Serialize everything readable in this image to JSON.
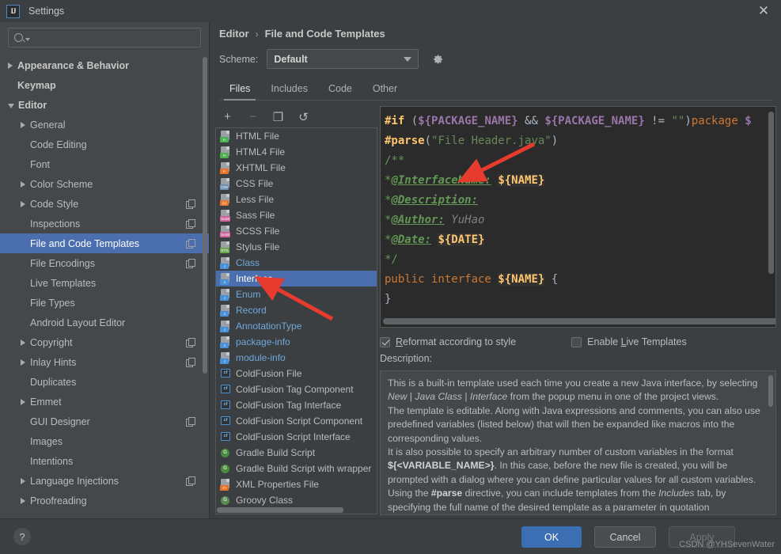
{
  "window": {
    "title": "Settings",
    "logo_text": "IJ",
    "close_label": "✕"
  },
  "sidebar": {
    "search_placeholder": "",
    "search_value": "",
    "items": [
      {
        "label": "Appearance & Behavior",
        "indent": 0,
        "arrow": "closed",
        "bold": true,
        "copy": false,
        "selected": false
      },
      {
        "label": "Keymap",
        "indent": 0,
        "arrow": "none",
        "bold": true,
        "copy": false,
        "selected": false
      },
      {
        "label": "Editor",
        "indent": 0,
        "arrow": "open",
        "bold": true,
        "copy": false,
        "selected": false
      },
      {
        "label": "General",
        "indent": 1,
        "arrow": "closed",
        "bold": false,
        "copy": false,
        "selected": false
      },
      {
        "label": "Code Editing",
        "indent": 1,
        "arrow": "none",
        "bold": false,
        "copy": false,
        "selected": false
      },
      {
        "label": "Font",
        "indent": 1,
        "arrow": "none",
        "bold": false,
        "copy": false,
        "selected": false
      },
      {
        "label": "Color Scheme",
        "indent": 1,
        "arrow": "closed",
        "bold": false,
        "copy": false,
        "selected": false
      },
      {
        "label": "Code Style",
        "indent": 1,
        "arrow": "closed",
        "bold": false,
        "copy": true,
        "selected": false
      },
      {
        "label": "Inspections",
        "indent": 1,
        "arrow": "none",
        "bold": false,
        "copy": true,
        "selected": false
      },
      {
        "label": "File and Code Templates",
        "indent": 1,
        "arrow": "none",
        "bold": false,
        "copy": true,
        "selected": true
      },
      {
        "label": "File Encodings",
        "indent": 1,
        "arrow": "none",
        "bold": false,
        "copy": true,
        "selected": false
      },
      {
        "label": "Live Templates",
        "indent": 1,
        "arrow": "none",
        "bold": false,
        "copy": false,
        "selected": false
      },
      {
        "label": "File Types",
        "indent": 1,
        "arrow": "none",
        "bold": false,
        "copy": false,
        "selected": false
      },
      {
        "label": "Android Layout Editor",
        "indent": 1,
        "arrow": "none",
        "bold": false,
        "copy": false,
        "selected": false
      },
      {
        "label": "Copyright",
        "indent": 1,
        "arrow": "closed",
        "bold": false,
        "copy": true,
        "selected": false
      },
      {
        "label": "Inlay Hints",
        "indent": 1,
        "arrow": "closed",
        "bold": false,
        "copy": true,
        "selected": false
      },
      {
        "label": "Duplicates",
        "indent": 1,
        "arrow": "none",
        "bold": false,
        "copy": false,
        "selected": false
      },
      {
        "label": "Emmet",
        "indent": 1,
        "arrow": "closed",
        "bold": false,
        "copy": false,
        "selected": false
      },
      {
        "label": "GUI Designer",
        "indent": 1,
        "arrow": "none",
        "bold": false,
        "copy": true,
        "selected": false
      },
      {
        "label": "Images",
        "indent": 1,
        "arrow": "none",
        "bold": false,
        "copy": false,
        "selected": false
      },
      {
        "label": "Intentions",
        "indent": 1,
        "arrow": "none",
        "bold": false,
        "copy": false,
        "selected": false
      },
      {
        "label": "Language Injections",
        "indent": 1,
        "arrow": "closed",
        "bold": false,
        "copy": true,
        "selected": false
      },
      {
        "label": "Proofreading",
        "indent": 1,
        "arrow": "closed",
        "bold": false,
        "copy": false,
        "selected": false
      }
    ]
  },
  "header": {
    "breadcrumb_parent": "Editor",
    "breadcrumb_sep": "›",
    "breadcrumb_current": "File and Code Templates",
    "scheme_label": "Scheme:",
    "scheme_value": "Default",
    "gear_icon": "gear-icon"
  },
  "tabs": [
    {
      "label": "Files",
      "active": true
    },
    {
      "label": "Includes",
      "active": false
    },
    {
      "label": "Code",
      "active": false
    },
    {
      "label": "Other",
      "active": false
    }
  ],
  "list_toolbar": [
    {
      "name": "add-template-button",
      "glyph": "+",
      "disabled": false
    },
    {
      "name": "remove-template-button",
      "glyph": "−",
      "disabled": true
    },
    {
      "name": "copy-template-button",
      "glyph": "❐",
      "disabled": false
    },
    {
      "name": "reset-template-button",
      "glyph": "↺",
      "disabled": false
    }
  ],
  "templates": [
    {
      "label": "HTML File",
      "icon": "html-file-icon",
      "kind": "badge",
      "badge": "H",
      "badge_color": "#4caf50",
      "selected": false,
      "java": false
    },
    {
      "label": "HTML4 File",
      "icon": "html4-file-icon",
      "kind": "badge",
      "badge": "H",
      "badge_color": "#4caf50",
      "selected": false,
      "java": false
    },
    {
      "label": "XHTML File",
      "icon": "xhtml-file-icon",
      "kind": "badge",
      "badge": "H",
      "badge_color": "#e8722a",
      "selected": false,
      "java": false
    },
    {
      "label": "CSS File",
      "icon": "css-file-icon",
      "kind": "badge",
      "badge": "CSS",
      "badge_color": "#6b8fb5",
      "selected": false,
      "java": false
    },
    {
      "label": "Less File",
      "icon": "less-file-icon",
      "kind": "badge",
      "badge": "{L}",
      "badge_color": "#e8722a",
      "selected": false,
      "java": false
    },
    {
      "label": "Sass File",
      "icon": "sass-file-icon",
      "kind": "badge",
      "badge": "SASS",
      "badge_color": "#cf649a",
      "selected": false,
      "java": false
    },
    {
      "label": "SCSS File",
      "icon": "scss-file-icon",
      "kind": "badge",
      "badge": "SASS",
      "badge_color": "#cf649a",
      "selected": false,
      "java": false
    },
    {
      "label": "Stylus File",
      "icon": "stylus-file-icon",
      "kind": "badge",
      "badge": "STYL",
      "badge_color": "#6aa84f",
      "selected": false,
      "java": false
    },
    {
      "label": "Class",
      "icon": "java-class-icon",
      "kind": "badge",
      "badge": "J",
      "badge_color": "#4a90d9",
      "selected": false,
      "java": true
    },
    {
      "label": "Interface",
      "icon": "java-interface-icon",
      "kind": "badge",
      "badge": "J",
      "badge_color": "#4a90d9",
      "selected": true,
      "java": true
    },
    {
      "label": "Enum",
      "icon": "java-enum-icon",
      "kind": "badge",
      "badge": "J",
      "badge_color": "#4a90d9",
      "selected": false,
      "java": true
    },
    {
      "label": "Record",
      "icon": "java-record-icon",
      "kind": "badge",
      "badge": "J",
      "badge_color": "#4a90d9",
      "selected": false,
      "java": true
    },
    {
      "label": "AnnotationType",
      "icon": "java-annotation-icon",
      "kind": "badge",
      "badge": "J",
      "badge_color": "#4a90d9",
      "selected": false,
      "java": true
    },
    {
      "label": "package-info",
      "icon": "package-info-icon",
      "kind": "badge",
      "badge": "J",
      "badge_color": "#4a90d9",
      "selected": false,
      "java": true
    },
    {
      "label": "module-info",
      "icon": "module-info-icon",
      "kind": "badge",
      "badge": "J",
      "badge_color": "#4a90d9",
      "selected": false,
      "java": true
    },
    {
      "label": "ColdFusion File",
      "icon": "coldfusion-icon",
      "kind": "cf",
      "badge": "cf",
      "badge_color": "#4a90d9",
      "selected": false,
      "java": false
    },
    {
      "label": "ColdFusion Tag Component",
      "icon": "coldfusion-icon",
      "kind": "cf",
      "badge": "cf",
      "badge_color": "#4a90d9",
      "selected": false,
      "java": false
    },
    {
      "label": "ColdFusion Tag Interface",
      "icon": "coldfusion-icon",
      "kind": "cf",
      "badge": "cf",
      "badge_color": "#4a90d9",
      "selected": false,
      "java": false
    },
    {
      "label": "ColdFusion Script Component",
      "icon": "coldfusion-icon",
      "kind": "cf",
      "badge": "cf",
      "badge_color": "#4a90d9",
      "selected": false,
      "java": false
    },
    {
      "label": "ColdFusion Script Interface",
      "icon": "coldfusion-icon",
      "kind": "cf",
      "badge": "cf",
      "badge_color": "#4a90d9",
      "selected": false,
      "java": false
    },
    {
      "label": "Gradle Build Script",
      "icon": "gradle-icon",
      "kind": "gr",
      "badge": "G",
      "badge_color": "#4a8c3f",
      "selected": false,
      "java": false
    },
    {
      "label": "Gradle Build Script with wrapper",
      "icon": "gradle-icon",
      "kind": "gr",
      "badge": "G",
      "badge_color": "#4a8c3f",
      "selected": false,
      "java": false
    },
    {
      "label": "XML Properties File",
      "icon": "xml-properties-icon",
      "kind": "badge",
      "badge": "<>",
      "badge_color": "#e8722a",
      "selected": false,
      "java": false
    },
    {
      "label": "Groovy Class",
      "icon": "groovy-class-icon",
      "kind": "gy",
      "badge": "G",
      "badge_color": "#5a8a55",
      "selected": false,
      "java": false
    }
  ],
  "editor": {
    "lines": [
      [
        {
          "t": "#if",
          "c": "c-dir"
        },
        {
          "t": " (",
          "c": "c-op"
        },
        {
          "t": "${PACKAGE_NAME}",
          "c": "c-varp"
        },
        {
          "t": " && ",
          "c": "c-op"
        },
        {
          "t": "${PACKAGE_NAME}",
          "c": "c-varp"
        },
        {
          "t": " != ",
          "c": "c-op"
        },
        {
          "t": "\"\"",
          "c": "c-str"
        },
        {
          "t": ")",
          "c": "c-op"
        },
        {
          "t": "package",
          "c": "c-kw"
        },
        {
          "t": " $",
          "c": "c-varp"
        }
      ],
      [
        {
          "t": "#parse",
          "c": "c-dir"
        },
        {
          "t": "(",
          "c": "c-op"
        },
        {
          "t": "\"File Header.java\"",
          "c": "c-str"
        },
        {
          "t": ")",
          "c": "c-op"
        }
      ],
      [
        {
          "t": "/**",
          "c": "c-cmt"
        }
      ],
      [
        {
          "t": "*",
          "c": "c-cmt"
        },
        {
          "t": "@InterfaceName:",
          "c": "c-cmt-b"
        },
        {
          "t": " ",
          "c": "c-cmt"
        },
        {
          "t": "${NAME}",
          "c": "c-var"
        }
      ],
      [
        {
          "t": "*",
          "c": "c-cmt"
        },
        {
          "t": "@Description:",
          "c": "c-cmt-b"
        }
      ],
      [
        {
          "t": "*",
          "c": "c-cmt"
        },
        {
          "t": "@Author:",
          "c": "c-cmt-b"
        },
        {
          "t": " YuHao",
          "c": "c-cmt-i"
        }
      ],
      [
        {
          "t": "*",
          "c": "c-cmt"
        },
        {
          "t": "@Date:",
          "c": "c-cmt-b"
        },
        {
          "t": " ",
          "c": "c-cmt"
        },
        {
          "t": "${DATE}",
          "c": "c-var"
        }
      ],
      [
        {
          "t": "*/",
          "c": "c-cmt"
        }
      ],
      [
        {
          "t": "public interface",
          "c": "c-kw"
        },
        {
          "t": " ",
          "c": "c-plain"
        },
        {
          "t": "${NAME}",
          "c": "c-var"
        },
        {
          "t": " {",
          "c": "c-plain"
        }
      ],
      [
        {
          "t": "}",
          "c": "c-plain"
        }
      ]
    ]
  },
  "options": {
    "reformat": {
      "label_pre": "",
      "mnemonic": "R",
      "label_post": "eformat according to style",
      "checked": true
    },
    "live_templates": {
      "label_pre": "Enable ",
      "mnemonic": "L",
      "label_post": "ive Templates",
      "checked": false
    }
  },
  "description": {
    "label": "Description:",
    "paragraphs": [
      {
        "segments": [
          {
            "t": "This is a built-in template used each time you create a new Java interface, by selecting ",
            "s": "n"
          },
          {
            "t": "New",
            "s": "i"
          },
          {
            "t": " | ",
            "s": "n"
          },
          {
            "t": "Java Class",
            "s": "i"
          },
          {
            "t": " | ",
            "s": "n"
          },
          {
            "t": "Interface",
            "s": "i"
          },
          {
            "t": " from the popup menu in one of the project views.",
            "s": "n"
          }
        ]
      },
      {
        "segments": [
          {
            "t": "The template is editable. Along with Java expressions and comments, you can also use predefined variables (listed below) that will then be expanded like macros into the corresponding values.",
            "s": "n"
          }
        ]
      },
      {
        "segments": [
          {
            "t": "It is also possible to specify an arbitrary number of custom variables in the format ",
            "s": "n"
          },
          {
            "t": "${<VARIABLE_NAME>}",
            "s": "b"
          },
          {
            "t": ". In this case, before the new file is created, you will be prompted with a dialog where you can define particular values for all custom variables.",
            "s": "n"
          }
        ]
      },
      {
        "segments": [
          {
            "t": "Using the ",
            "s": "n"
          },
          {
            "t": "#parse",
            "s": "b"
          },
          {
            "t": " directive, you can include templates from the ",
            "s": "n"
          },
          {
            "t": "Includes",
            "s": "i"
          },
          {
            "t": " tab, by specifying the full name of the desired template as a parameter in quotation",
            "s": "n"
          }
        ]
      }
    ]
  },
  "footer": {
    "help_label": "?",
    "ok_label": "OK",
    "cancel_label": "Cancel",
    "apply_label": "Apply",
    "watermark": "CSDN @YHSevenWater"
  },
  "colors": {
    "accent_blue": "#4b6eaf",
    "primary_button": "#3c6eb4",
    "window_bg": "#3c3f41",
    "sidebar_bg": "#45484a",
    "editor_bg": "#2b2b2b",
    "arrow_red": "#e83b2f"
  },
  "annotations": [
    {
      "name": "arrow-to-interface-row",
      "target": "Interface"
    },
    {
      "name": "arrow-to-javadoc-line",
      "target": "*@InterfaceName:"
    }
  ]
}
